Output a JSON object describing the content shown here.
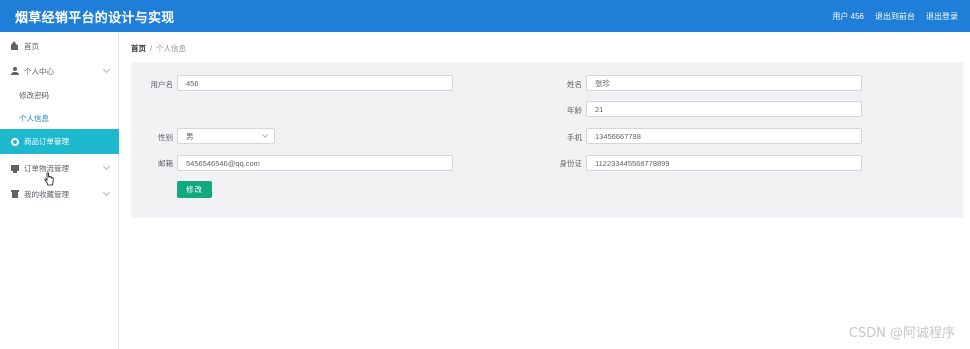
{
  "header": {
    "title": "烟草经销平台的设计与实现",
    "user_label": "用户 456",
    "to_backend": "退出到前台",
    "logout": "退出登录"
  },
  "sidebar": {
    "items": [
      {
        "label": "首页",
        "icon": "home-icon"
      },
      {
        "label": "个人中心",
        "icon": "user-icon"
      },
      {
        "label": "修改密码"
      },
      {
        "label": "个人信息"
      },
      {
        "label": "商品订单管理",
        "icon": "gear-icon"
      },
      {
        "label": "订单物流管理",
        "icon": "doc-icon"
      },
      {
        "label": "我的收藏管理",
        "icon": "trash-icon"
      }
    ]
  },
  "breadcrumb": {
    "home": "首页",
    "separator": "/",
    "current": "个人信息"
  },
  "form": {
    "username_label": "用户名",
    "username_value": "456",
    "name_label": "姓名",
    "name_value": "张珍",
    "age_label": "年龄",
    "age_value": "21",
    "gender_label": "性别",
    "gender_value": "男",
    "phone_label": "手机",
    "phone_value": "13456667788",
    "email_label": "邮箱",
    "email_value": "5456546546@qq.com",
    "idcard_label": "身份证",
    "idcard_value": "112233445566778899",
    "submit_label": "修改"
  },
  "watermark": "CSDN @阿诚程序",
  "colors": {
    "header_bg": "#1e7ed8",
    "active_menu_bg": "#1fb9cf",
    "button_bg": "#13a97e",
    "panel_bg": "#f2f2f4"
  }
}
